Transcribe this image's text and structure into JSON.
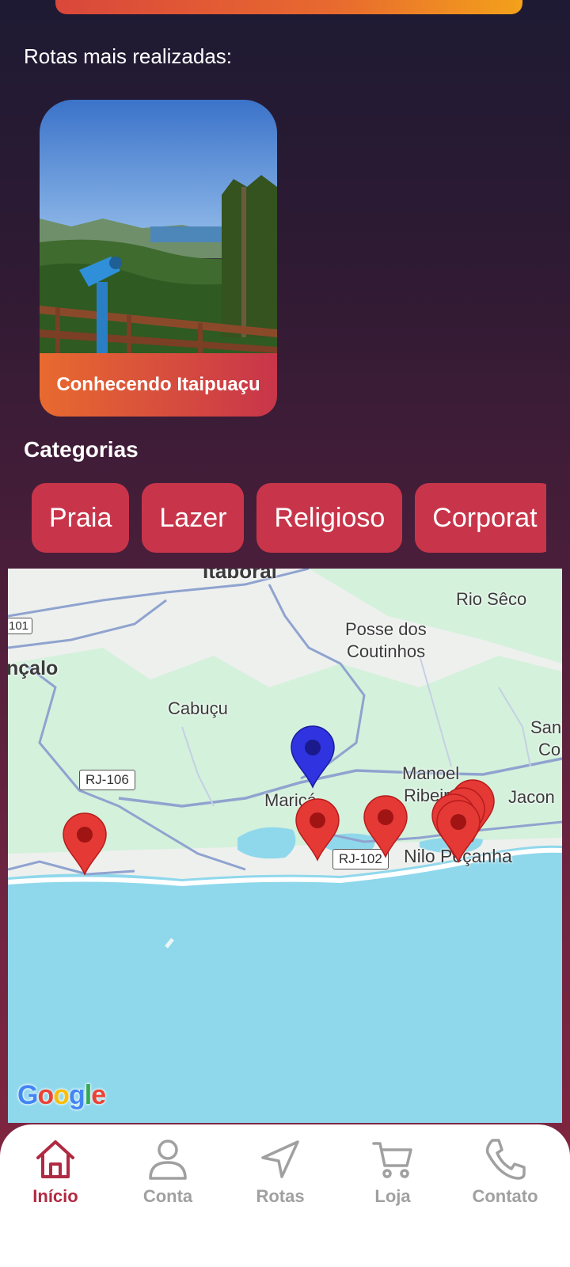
{
  "header": {
    "section_label": "Rotas mais realizadas:"
  },
  "routes": [
    {
      "title": "Conhecendo Itaipuaçu"
    }
  ],
  "categories": {
    "title": "Categorias",
    "items": [
      "Praia",
      "Lazer",
      "Religioso",
      "Corporat"
    ]
  },
  "map": {
    "labels": {
      "itaborai": "Itaboraí",
      "rio_seco": "Rio Sêco",
      "posse_1": "Posse dos",
      "posse_2": "Coutinhos",
      "goncalo": "nçalo",
      "cabucu": "Cabuçu",
      "san": "San",
      "co": "Co",
      "manoel": "Manoel",
      "ribeiro": "Ribeiro",
      "jacon": "Jacon",
      "marica": "Maricá",
      "nilo": "Nilo Peçanha"
    },
    "shields": {
      "rj106": "RJ-106",
      "rj102": "RJ-102",
      "br101": "101"
    },
    "attribution": "Google",
    "colors": {
      "sea": "#8fd8ec",
      "land": "#eef0ee",
      "green": "#d4f1dc",
      "road": "#8fa3cf",
      "marker_red": "#e53935",
      "marker_blue": "#2f34e0"
    }
  },
  "nav": {
    "items": [
      {
        "label": "Início",
        "icon": "home-icon",
        "active": true
      },
      {
        "label": "Conta",
        "icon": "user-icon",
        "active": false
      },
      {
        "label": "Rotas",
        "icon": "navigation-arrow-icon",
        "active": false
      },
      {
        "label": "Loja",
        "icon": "cart-icon",
        "active": false
      },
      {
        "label": "Contato",
        "icon": "phone-icon",
        "active": false
      }
    ],
    "active_color": "#b02a43",
    "inactive_color": "#a0a0a0"
  }
}
